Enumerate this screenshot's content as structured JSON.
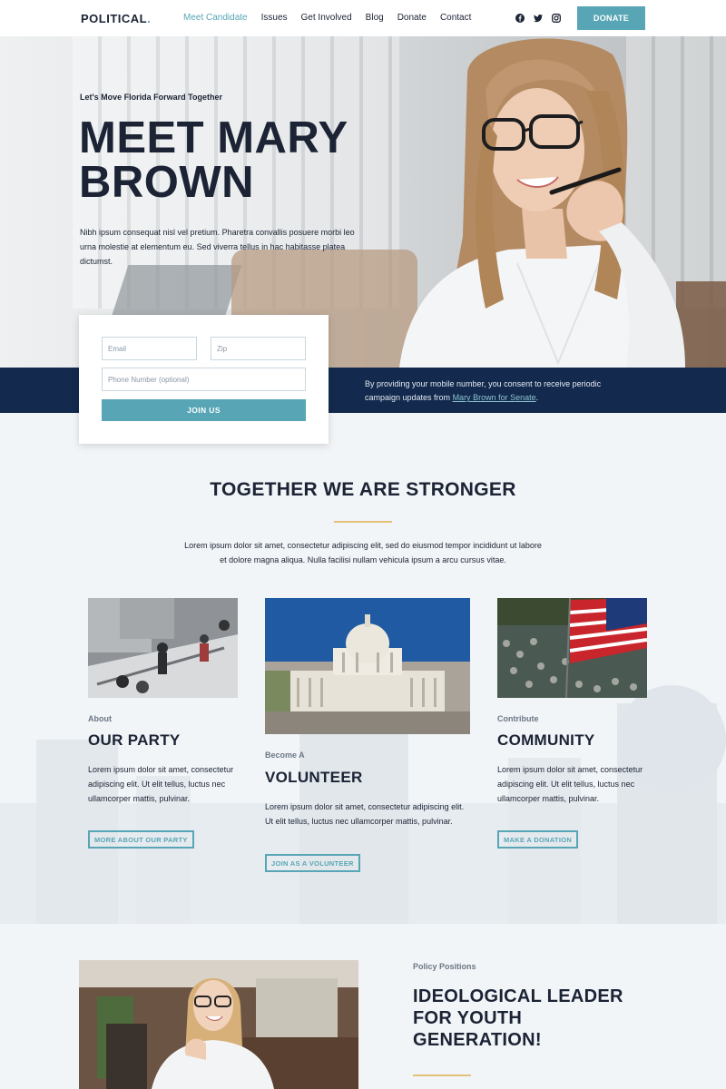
{
  "nav": {
    "logo": "POLITICAL",
    "logo_dot": ".",
    "items": [
      "Meet Candidate",
      "Issues",
      "Get Involved",
      "Blog",
      "Donate",
      "Contact"
    ],
    "donate_button": "DONATE",
    "social_icons": [
      "facebook-icon",
      "twitter-icon",
      "instagram-icon"
    ]
  },
  "hero": {
    "subtitle": "Let's Move Florida Forward Together",
    "title": "MEET MARY BROWN",
    "text": "Nibh ipsum consequat nisl vel pretium. Pharetra convallis posuere morbi leo urna molestie at elementum eu. Sed viverra tellus in hac habitasse platea dictumst."
  },
  "form": {
    "email_placeholder": "Email",
    "zip_placeholder": "Zip",
    "phone_placeholder": "Phone Number (optional)",
    "join_button": "JOIN US"
  },
  "consent": {
    "text": "By providing your mobile number, you consent to receive periodic campaign updates from ",
    "link": "Mary Brown for Senate",
    "end": "."
  },
  "together": {
    "title": "TOGETHER WE ARE STRONGER",
    "text": "Lorem ipsum dolor sit amet, consectetur adipiscing elit, sed do eiusmod tempor incididunt ut labore et dolore magna aliqua. Nulla facilisi nullam vehicula ipsum a arcu cursus vitae."
  },
  "columns": [
    {
      "kicker": "About",
      "title": "OUR PARTY",
      "text": "Lorem ipsum dolor sit amet, consectetur adipiscing elit. Ut elit tellus, luctus nec ullamcorper mattis, pulvinar.",
      "button": "MORE ABOUT OUR PARTY"
    },
    {
      "kicker": "Become A",
      "title": "VOLUNTEER",
      "text": "Lorem ipsum dolor sit amet, consectetur adipiscing elit. Ut elit tellus, luctus nec ullamcorper mattis, pulvinar.",
      "button": "JOIN AS A VOLUNTEER"
    },
    {
      "kicker": "Contribute",
      "title": "COMMUNITY",
      "text": "Lorem ipsum dolor sit amet, consectetur adipiscing elit. Ut elit tellus, luctus nec ullamcorper mattis, pulvinar.",
      "button": "MAKE A DONATION"
    }
  ],
  "policy": {
    "kicker": "Policy Positions",
    "title": "IDEOLOGICAL LEADER FOR YOUTH GENERATION!"
  },
  "colors": {
    "accent": "#57a5b5",
    "navy": "#132a4e",
    "dark_text": "#1b2334",
    "gold_line": "#e3c277"
  }
}
